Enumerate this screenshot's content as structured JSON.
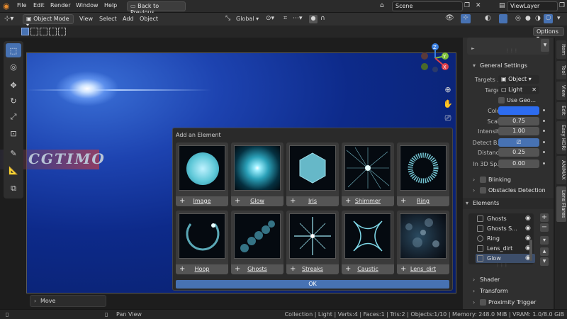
{
  "menubar": {
    "items": [
      "File",
      "Edit",
      "Render",
      "Window",
      "Help"
    ],
    "back_button": "Back to Previous",
    "scene_label": "Scene",
    "viewlayer_label": "ViewLayer"
  },
  "header": {
    "mode": "Object Mode",
    "menus": [
      "View",
      "Select",
      "Add",
      "Object"
    ],
    "transform_orientation": "Global",
    "options_label": "Options"
  },
  "toolbar": {
    "tools": [
      "select-box-icon",
      "cursor-icon",
      "move-icon",
      "rotate-icon",
      "scale-icon",
      "transform-icon",
      "annotate-icon",
      "measure-icon",
      "add-cube-icon"
    ],
    "active_index": 0
  },
  "viewport": {
    "watermark": "CGTIMO",
    "gizmo_axes": [
      "Z",
      "Y",
      "X"
    ],
    "gizmo_colors": {
      "x": "#e0404a",
      "y": "#7fc03a",
      "z": "#3a7fe0"
    }
  },
  "dialog": {
    "title": "Add an Element",
    "elements": [
      {
        "label": "Image"
      },
      {
        "label": "Glow"
      },
      {
        "label": "Iris"
      },
      {
        "label": "Shimmer"
      },
      {
        "label": "Ring"
      },
      {
        "label": "Hoop"
      },
      {
        "label": "Ghosts"
      },
      {
        "label": "Streaks"
      },
      {
        "label": "Caustic"
      },
      {
        "label": "Lens_dirt"
      }
    ],
    "ok_label": "OK"
  },
  "sidebar": {
    "general_settings": "General Settings",
    "targets_label": "Targets ...",
    "targets_value": "Object",
    "target_label": "Target",
    "target_value": "Light",
    "use_geo_label": "Use Geo...",
    "color_label": "Color",
    "color_value": "#2d6cf0",
    "scale_label": "Scale",
    "scale_value": "0.75",
    "intensity_label": "Intensity",
    "intensity_value": "1.00",
    "detect_label": "Detect B...",
    "distance_label": "Distance",
    "distance_value": "0.25",
    "in3d_label": "In 3D Sp...",
    "in3d_value": "0.00",
    "blinking": "Blinking",
    "obstacles": "Obstacles Detection",
    "elements_title": "Elements",
    "element_list": [
      "Ghosts",
      "Ghosts S...",
      "Ring",
      "Lens_dirt",
      "Glow"
    ],
    "selected_element": 4,
    "shader": "Shader",
    "transform": "Transform",
    "proximity": "Proximity Trigger"
  },
  "vtabs": [
    "Item",
    "Tool",
    "View",
    "Edit",
    "Easy HDRI",
    "ANIMAX",
    "Lens Flares"
  ],
  "statusbar": {
    "move": "Move",
    "pan": "Pan View",
    "stats": "Collection | Light | Verts:4 | Faces:1 | Tris:2 | Objects:1/10 | Memory: 248.0 MiB | VRAM: 1.0/8.0 GiB"
  }
}
